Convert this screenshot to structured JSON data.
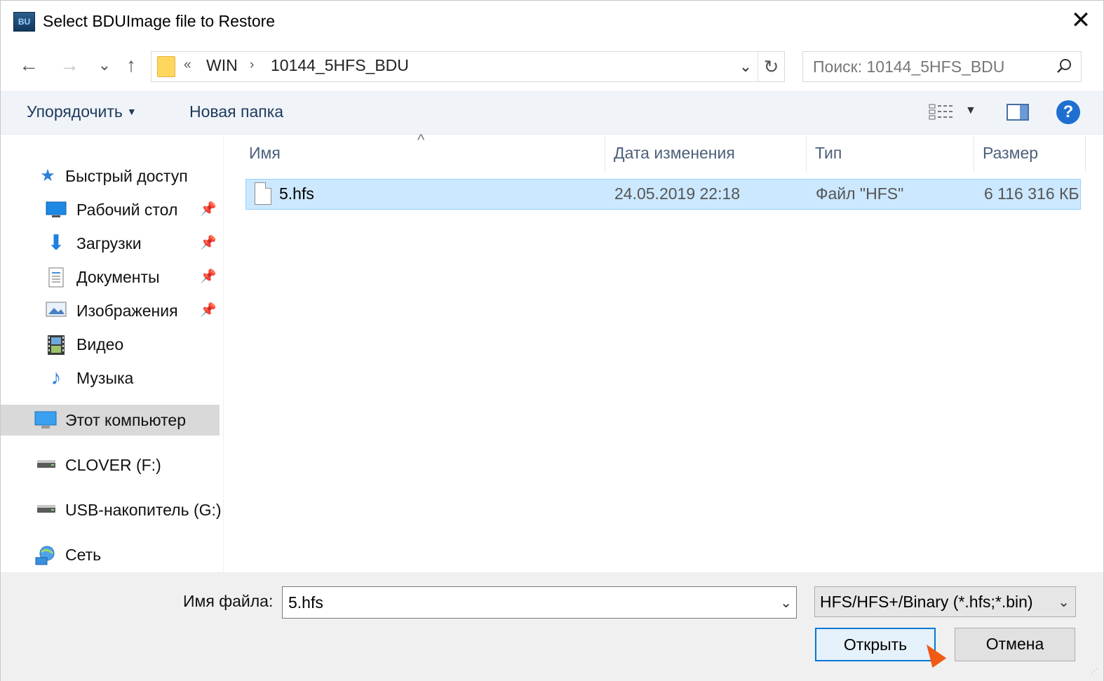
{
  "title_bar": {
    "app_icon_text": "BU",
    "title": "Select BDUImage file to Restore",
    "close_glyph": "✕"
  },
  "navigation": {
    "back_glyph": "←",
    "forward_glyph": "→",
    "recent_glyph": "⌄",
    "up_glyph": "↑",
    "address": {
      "overflow": "«",
      "crumbs": [
        "WIN",
        "10144_5HFS_BDU"
      ],
      "separator": "›",
      "dropdown_glyph": "⌄",
      "refresh_glyph": "↻"
    },
    "search": {
      "placeholder": "Поиск: 10144_5HFS_BDU",
      "icon": "search-icon"
    }
  },
  "command_bar": {
    "organize_label": "Упорядочить",
    "new_folder_label": "Новая папка",
    "help_glyph": "?"
  },
  "sidebar": {
    "items": [
      {
        "label": "Быстрый доступ",
        "icon": "star-icon",
        "pinned": false
      },
      {
        "label": "Рабочий стол",
        "icon": "desktop-icon",
        "pinned": true
      },
      {
        "label": "Загрузки",
        "icon": "download-icon",
        "pinned": true
      },
      {
        "label": "Документы",
        "icon": "document-icon",
        "pinned": true
      },
      {
        "label": "Изображения",
        "icon": "pictures-icon",
        "pinned": true
      },
      {
        "label": "Видео",
        "icon": "video-icon",
        "pinned": false
      },
      {
        "label": "Музыка",
        "icon": "music-icon",
        "pinned": false
      },
      {
        "label": "Этот компьютер",
        "icon": "computer-icon",
        "pinned": false,
        "selected": true
      },
      {
        "label": "CLOVER (F:)",
        "icon": "drive-icon",
        "pinned": false
      },
      {
        "label": "USB-накопитель (G:)",
        "icon": "drive-icon",
        "pinned": false
      },
      {
        "label": "Сеть",
        "icon": "network-icon",
        "pinned": false
      }
    ]
  },
  "file_list": {
    "columns": [
      "Имя",
      "Дата изменения",
      "Тип",
      "Размер"
    ],
    "sort_glyph": "^",
    "rows": [
      {
        "name": "5.hfs",
        "modified": "24.05.2019 22:18",
        "type": "Файл \"HFS\"",
        "size": "6 116 316 КБ",
        "selected": true
      }
    ]
  },
  "footer": {
    "filename_label": "Имя файла:",
    "filename_value": "5.hfs",
    "filetype_value": "HFS/HFS+/Binary (*.hfs;*.bin)",
    "open_label": "Открыть",
    "cancel_label": "Отмена"
  },
  "colors": {
    "selection_fill": "#cce8ff",
    "selection_border": "#99d1ff",
    "accent": "#0078d7",
    "cursor": "#f05a14"
  }
}
